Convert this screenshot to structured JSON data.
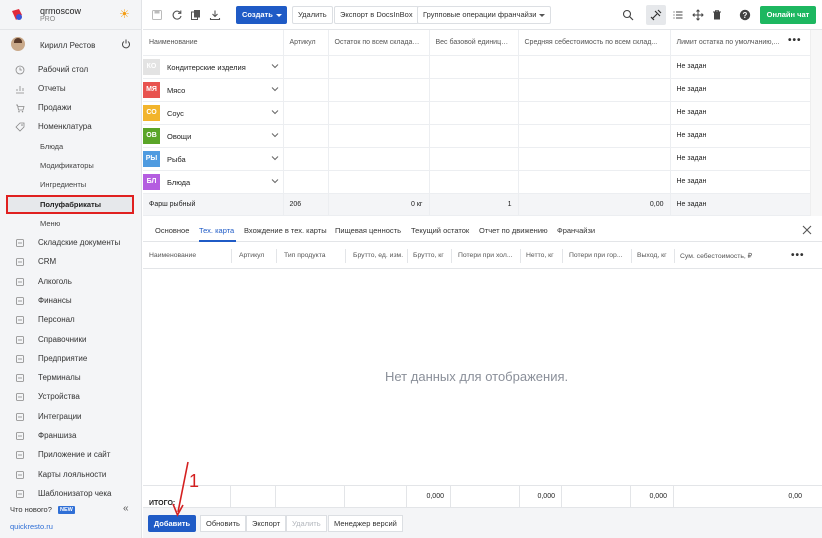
{
  "brand": {
    "name": "qrmoscow",
    "plan": "PRO"
  },
  "user": {
    "name": "Кирилл Рестов"
  },
  "sidebar": {
    "items": [
      {
        "label": "Рабочий стол",
        "icon": "clock-icon"
      },
      {
        "label": "Отчеты",
        "icon": "chart-icon"
      },
      {
        "label": "Продажи",
        "icon": "cart-icon"
      },
      {
        "label": "Номенклатура",
        "icon": "tag-icon"
      }
    ],
    "subitems": [
      "Блюда",
      "Модификаторы",
      "Ингредиенты",
      "Полуфабрикаты",
      "Меню"
    ],
    "items2": [
      {
        "label": "Складские документы",
        "icon": "box-icon"
      },
      {
        "label": "CRM",
        "icon": "people-icon"
      },
      {
        "label": "Алкоголь",
        "icon": "glass-icon"
      },
      {
        "label": "Финансы",
        "icon": "wallet-icon"
      },
      {
        "label": "Персонал",
        "icon": "person-icon"
      },
      {
        "label": "Справочники",
        "icon": "book-icon"
      },
      {
        "label": "Предприятие",
        "icon": "building-icon"
      },
      {
        "label": "Терминалы",
        "icon": "terminal-icon"
      },
      {
        "label": "Устройства",
        "icon": "device-icon"
      },
      {
        "label": "Интеграции",
        "icon": "link-icon"
      },
      {
        "label": "Франшиза",
        "icon": "network-icon"
      },
      {
        "label": "Приложение и сайт",
        "icon": "phone-icon"
      },
      {
        "label": "Карты лояльности",
        "icon": "card-icon"
      },
      {
        "label": "Шаблонизатор чека",
        "icon": "receipt-icon"
      }
    ],
    "whats_new": "Что нового?",
    "new_badge": "NEW",
    "site": "quickresto.ru"
  },
  "toolbar": {
    "create": "Создать",
    "delete": "Удалить",
    "export": "Экспорт в DocsInBox",
    "group_ops": "Групповые операции франчайзи",
    "chat": "Онлайн чат"
  },
  "top_table": {
    "headers": [
      "Наименование",
      "Артикул",
      "Остаток по всем складам,...",
      "Вес базовой единицы,...",
      "Средняя себестоимость по всем склад...",
      "Лимит остатка по умолчанию,..."
    ],
    "categories": [
      {
        "abbr": "КО",
        "name": "Кондитерские изделия",
        "color": "#e3e3e3",
        "limit": "Не задан"
      },
      {
        "abbr": "МЯ",
        "name": "Мясо",
        "color": "#e8534f",
        "limit": "Не задан"
      },
      {
        "abbr": "СО",
        "name": "Соус",
        "color": "#f2b42c",
        "limit": "Не задан"
      },
      {
        "abbr": "ОВ",
        "name": "Овощи",
        "color": "#5aa528",
        "limit": "Не задан"
      },
      {
        "abbr": "РЫ",
        "name": "Рыба",
        "color": "#4f9be0",
        "limit": "Не задан"
      },
      {
        "abbr": "БЛ",
        "name": "Блюда",
        "color": "#b45de0",
        "limit": "Не задан"
      }
    ],
    "item": {
      "name": "Фарш рыбный",
      "article": "206",
      "stock": "0 кг",
      "weight": "1",
      "cost": "0,00",
      "limit": "Не задан"
    }
  },
  "tabs": [
    "Основное",
    "Тех. карта",
    "Вхождение в тех. карты",
    "Пищевая ценность",
    "Текущий остаток",
    "Отчет по движению",
    "Франчайзи"
  ],
  "bottom_table": {
    "headers": [
      "Наименование",
      "Артикул",
      "Тип продукта",
      "Брутто, ед. изм.",
      "Брутто, кг",
      "Потери при хол...",
      "Нетто, кг",
      "Потери при гор...",
      "Выход, кг",
      "Сум. себестоимость, ₽"
    ],
    "empty": "Нет данных для отображения.",
    "total_label": "ИТОГО:",
    "totals": [
      "0,000",
      "0,000",
      "0,000",
      "0,00"
    ]
  },
  "bottombar": {
    "add": "Добавить",
    "refresh": "Обновить",
    "export": "Экспорт",
    "delete": "Удалить",
    "versions": "Менеджер версий"
  },
  "annotation": "1"
}
